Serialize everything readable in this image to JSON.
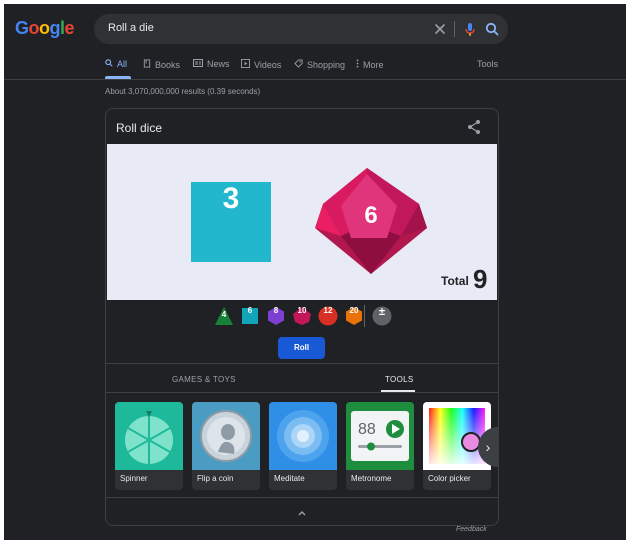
{
  "header": {
    "logo_text": "Google",
    "search_value": "Roll a die"
  },
  "nav": {
    "tabs": [
      {
        "label": "All",
        "icon": "search-icon"
      },
      {
        "label": "Books",
        "icon": "book-icon"
      },
      {
        "label": "News",
        "icon": "news-icon"
      },
      {
        "label": "Videos",
        "icon": "video-icon"
      },
      {
        "label": "Shopping",
        "icon": "tag-icon"
      },
      {
        "label": "More",
        "icon": "more-vert-icon"
      }
    ],
    "tools_label": "Tools",
    "active_tab": "All"
  },
  "result_stats": "About 3,070,000,000 results (0.39 seconds)",
  "card": {
    "title": "Roll dice",
    "dice": [
      {
        "type": "d6",
        "value": "3",
        "color": "#22b7cc"
      },
      {
        "type": "d10",
        "value": "6",
        "color": "#c2185b"
      }
    ],
    "total_label": "Total",
    "total_value": "9",
    "die_options": [
      {
        "label": "4",
        "color": "#188038"
      },
      {
        "label": "6",
        "color": "#12a4b8"
      },
      {
        "label": "8",
        "color": "#7b3fd1"
      },
      {
        "label": "10",
        "color": "#c2185b"
      },
      {
        "label": "12",
        "color": "#d93025"
      },
      {
        "label": "20",
        "color": "#e8710a"
      },
      {
        "label": "±",
        "color": "#5f6368"
      }
    ],
    "roll_label": "Roll",
    "category_tabs": [
      "GAMES & TOYS",
      "TOOLS"
    ],
    "active_category": "TOOLS",
    "tools": [
      {
        "label": "Spinner",
        "icon": "spinner-icon"
      },
      {
        "label": "Flip a coin",
        "icon": "coin-icon"
      },
      {
        "label": "Meditate",
        "icon": "meditate-icon"
      },
      {
        "label": "Metronome",
        "icon": "metronome-icon",
        "bpm": "88"
      },
      {
        "label": "Color picker",
        "icon": "color-picker-icon"
      }
    ]
  },
  "feedback_label": "Feedback"
}
